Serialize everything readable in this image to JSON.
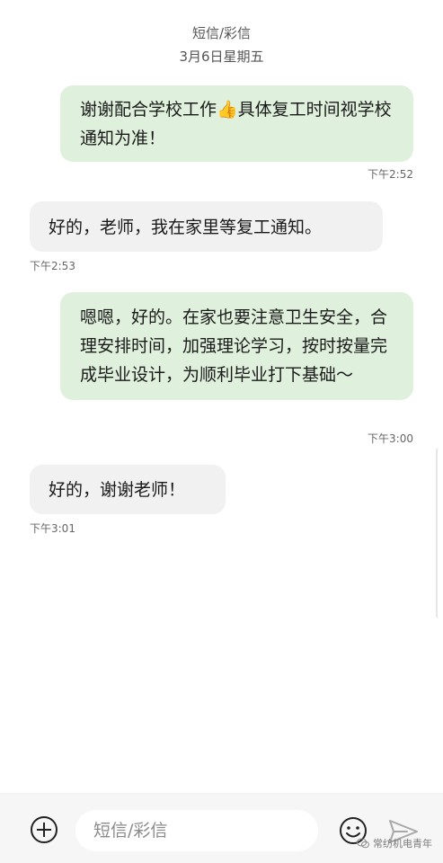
{
  "header": {
    "title": "短信/彩信",
    "date": "3月6日星期五"
  },
  "messages": [
    {
      "direction": "out",
      "text": "谢谢配合学校工作👍具体复工时间视学校通知为准！",
      "time": "下午2:52"
    },
    {
      "direction": "in",
      "text": "好的，老师，我在家里等复工通知。",
      "time": "下午2:53"
    },
    {
      "direction": "out",
      "text": "嗯嗯，好的。在家也要注意卫生安全，合理安排时间，加强理论学习，按时按量完成毕业设计，为顺利毕业打下基础～",
      "time": "下午3:00"
    },
    {
      "direction": "in",
      "text": "好的，谢谢老师！",
      "time": "下午3:01"
    }
  ],
  "composer": {
    "placeholder": "短信/彩信"
  },
  "watermark": {
    "text": "常纺机电青年"
  },
  "icons": {
    "attach": "plus-circle-icon",
    "emoji": "smiley-icon",
    "send": "send-arrow-icon"
  }
}
